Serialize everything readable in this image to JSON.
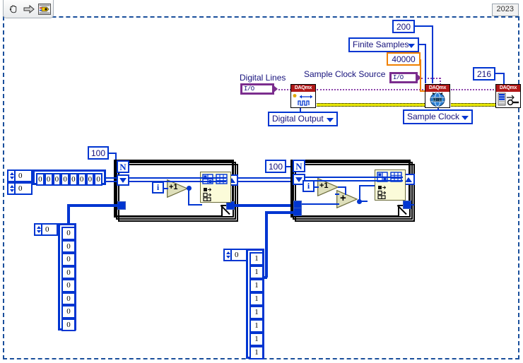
{
  "window": {
    "version_label": "2023",
    "toolbar": {
      "items": [
        {
          "name": "hand-tool-icon",
          "label": "Operate Value"
        },
        {
          "name": "arrow-right-icon",
          "label": "Run"
        },
        {
          "name": "vi-icon",
          "label": "VI Icon"
        }
      ]
    }
  },
  "labels": {
    "digital_lines": "Digital Lines",
    "sample_clock_source": "Sample Clock Source"
  },
  "daq_section": {
    "create_channel": {
      "node_title": "DAQmx",
      "polymorphic_label": "Digital Output"
    },
    "timing": {
      "node_title": "DAQmx",
      "polymorphic_label": "Sample Clock",
      "sample_mode": "Finite Samples",
      "samples_per_channel": "200",
      "rate": "40000"
    },
    "write": {
      "node_title": "DAQmx",
      "constant": "216"
    },
    "digital_lines_io": "I/O",
    "sample_clock_source_io": "I/O"
  },
  "loop_left": {
    "count_constant": "100",
    "count_terminal": "N",
    "iteration_terminal": "i",
    "increment_label": "+1"
  },
  "loop_right": {
    "count_constant": "100",
    "count_terminal": "N",
    "iteration_terminal": "i",
    "increment_label": "+1",
    "add_label": "+"
  },
  "array_2d_top": {
    "index_values": [
      "0",
      "0"
    ],
    "cells": [
      "0",
      "0",
      "0",
      "0",
      "0",
      "0",
      "0",
      "0"
    ]
  },
  "array_1d_left": {
    "index_value": "0",
    "cells": [
      "0",
      "0",
      "0",
      "0",
      "0",
      "0",
      "0",
      "0"
    ]
  },
  "array_1d_mid": {
    "index_value": "0",
    "cells": [
      "1",
      "1",
      "1",
      "1",
      "1",
      "1",
      "1",
      "1"
    ]
  },
  "colors": {
    "wire_blue": "#0035d1",
    "wire_purple": "#8e44ad",
    "wire_error_yellow": "#e8e800",
    "wire_orange": "#f08000",
    "daqmx_header_red": "#b01818",
    "node_body_cream": "#fbfbd9",
    "diagram_border": "#1a4f9c"
  },
  "chart_data": null
}
